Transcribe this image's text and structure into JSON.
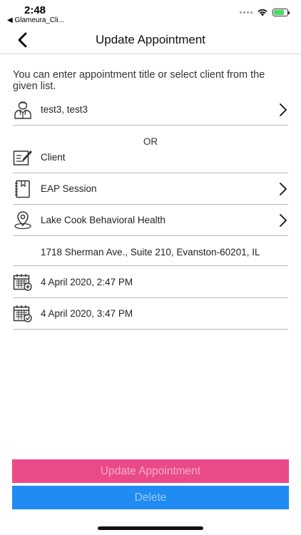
{
  "status_bar": {
    "time": "2:48",
    "back_app": "◀ Glameura_Cli...",
    "battery_level": 0.8
  },
  "nav": {
    "title": "Update Appointment"
  },
  "intro_text": "You can enter appointment title or select client from the given list.",
  "client_row": {
    "label": "test3, test3",
    "icon": "person-icon"
  },
  "or_text": "OR",
  "title_row": {
    "label": "Client",
    "icon": "edit-note-icon"
  },
  "session_row": {
    "label": "EAP Session",
    "icon": "notebook-icon"
  },
  "location_row": {
    "label": "Lake Cook Behavioral Health",
    "icon": "location-pin-icon"
  },
  "address": "1718 Sherman Ave.,  Suite 210, Evanston-60201, IL",
  "start_row": {
    "label": "4 April 2020, 2:47 PM",
    "icon": "calendar-add-icon"
  },
  "end_row": {
    "label": "4 April 2020, 3:47 PM",
    "icon": "calendar-check-icon"
  },
  "buttons": {
    "update": "Update Appointment",
    "delete": "Delete"
  },
  "colors": {
    "update_button": "#ea4a88",
    "delete_button": "#1f8bf3",
    "battery": "#4cd964"
  }
}
